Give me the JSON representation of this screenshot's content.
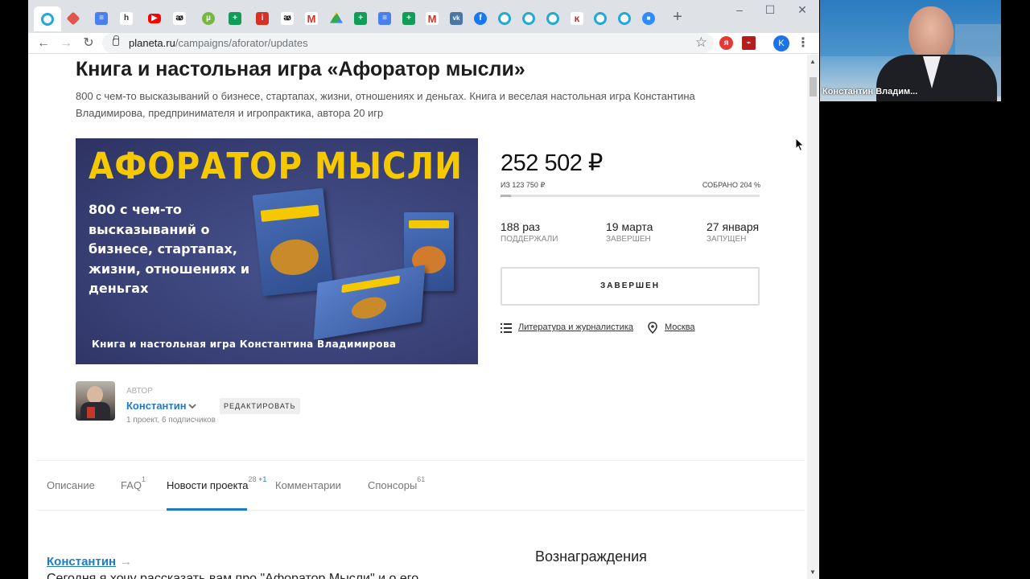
{
  "browser": {
    "url_domain": "planeta.ru",
    "url_path": "/campaigns/aforator/updates",
    "new_tab_symbol": "+",
    "profile_initial": "K",
    "active_tab_icon": "planeta-ring-icon"
  },
  "page": {
    "title": "Книга и настольная игра «Афоратор мысли»",
    "subtitle": "800 с чем-то высказываний о бизнесе, стартапах, жизни, отношениях и деньгах. Книга и веселая настольная игра Константина Владимирова, предпринимателя и игропрактика, автора 20 игр"
  },
  "banner": {
    "title": "АФОРАТОР МЫСЛИ",
    "description": "800 с чем-то высказываний о бизнесе, стартапах, жизни, отношениях и деньгах",
    "footer": "Книга и настольная игра Константина Владимирова",
    "colors": {
      "title": "#f5c800",
      "background": "#3a4278"
    }
  },
  "campaign": {
    "amount": "252 502 ₽",
    "goal": "из 123 750 ₽",
    "collected": "собрано 204 %",
    "progress_fraction": 0.04,
    "stats": [
      {
        "value": "188 раз",
        "label": "поддержали"
      },
      {
        "value": "19 марта",
        "label": "завершен"
      },
      {
        "value": "27 января",
        "label": "запущен"
      }
    ],
    "status_button": "ЗАВЕРШЕН",
    "category": "Литература и журналистика",
    "location": "Москва"
  },
  "author": {
    "label": "автор",
    "name": "Константин",
    "meta": "1 проект, 6 подписчиков",
    "edit_button": "РЕДАКТИРОВАТЬ"
  },
  "tabs": [
    {
      "label": "Описание",
      "count": "",
      "new": ""
    },
    {
      "label": "FAQ",
      "count": "1",
      "new": ""
    },
    {
      "label": "Новости проекта",
      "count": "28",
      "new": "+1"
    },
    {
      "label": "Комментарии",
      "count": "",
      "new": ""
    },
    {
      "label": "Спонсоры",
      "count": "61",
      "new": ""
    }
  ],
  "post": {
    "author": "Константин",
    "arrow": "→",
    "text_preview": "Сегодня я хочу рассказать вам про \"Афоратор Мысли\" и о его"
  },
  "sidebar": {
    "rewards_title": "Вознаграждения"
  },
  "webcam": {
    "name": "Константин Владим..."
  },
  "colors": {
    "accent": "#1f7bc8",
    "tab_strip": "#dee1e6"
  }
}
